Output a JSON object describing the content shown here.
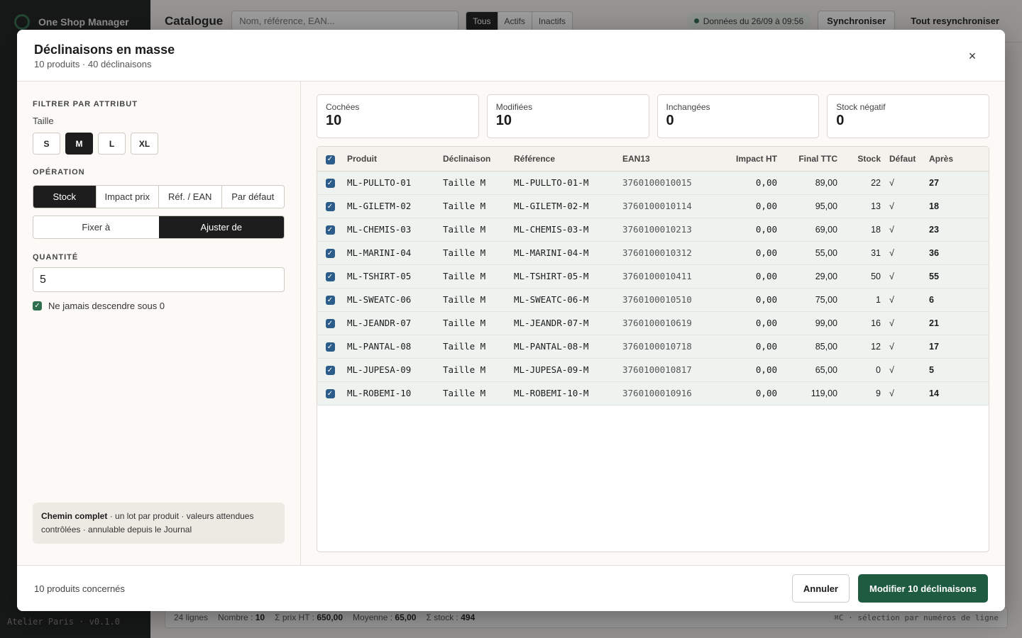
{
  "app": {
    "name": "One Shop Manager",
    "version": "Atelier Paris · v0.1.0",
    "page_title": "Catalogue",
    "search_placeholder": "Nom, référence, EAN...",
    "filters": [
      "Tous",
      "Actifs",
      "Inactifs"
    ],
    "sync_badge": "Données du 26/09 à 09:56",
    "sync_button": "Synchroniser",
    "resync_button": "Tout resynchroniser",
    "statusbar": {
      "lines": "24 lignes",
      "count_label": "Nombre :",
      "count_value": "10",
      "price_label": "Σ prix HT :",
      "price_value": "650,00",
      "avg_label": "Moyenne :",
      "avg_value": "65,00",
      "stock_label": "Σ stock :",
      "stock_value": "494",
      "hint": "⌘C · sélection par numéros de ligne"
    }
  },
  "modal": {
    "title": "Déclinaisons en masse",
    "subtitle": "10 produits · 40 déclinaisons",
    "close_glyph": "×",
    "filter_label": "Filtrer par attribut",
    "attribute_label": "Taille",
    "sizes": [
      "S",
      "M",
      "L",
      "XL"
    ],
    "operation_label": "Opération",
    "operations": [
      "Stock",
      "Impact prix",
      "Réf. / EAN",
      "Par défaut"
    ],
    "modes": [
      "Fixer à",
      "Ajuster de"
    ],
    "quantity_label": "Quantité",
    "quantity_value": "5",
    "never_below_zero": "Ne jamais descendre sous 0",
    "info_bold": "Chemin complet",
    "info_text": " · un lot par produit · valeurs attendues contrôlées · annulable depuis le Journal",
    "stats": [
      {
        "label": "Cochées",
        "value": "10"
      },
      {
        "label": "Modifiées",
        "value": "10"
      },
      {
        "label": "Inchangées",
        "value": "0"
      },
      {
        "label": "Stock négatif",
        "value": "0"
      }
    ],
    "columns": [
      "Produit",
      "Déclinaison",
      "Référence",
      "EAN13",
      "Impact HT",
      "Final TTC",
      "Stock",
      "Défaut",
      "Après"
    ],
    "rows": [
      {
        "produit": "ML-PULLTO-01",
        "declinaison": "Taille M",
        "reference": "ML-PULLTO-01-M",
        "ean": "3760100010015",
        "impact": "0,00",
        "final": "89,00",
        "stock": "22",
        "defaut": "√",
        "apres": "27"
      },
      {
        "produit": "ML-GILETM-02",
        "declinaison": "Taille M",
        "reference": "ML-GILETM-02-M",
        "ean": "3760100010114",
        "impact": "0,00",
        "final": "95,00",
        "stock": "13",
        "defaut": "√",
        "apres": "18"
      },
      {
        "produit": "ML-CHEMIS-03",
        "declinaison": "Taille M",
        "reference": "ML-CHEMIS-03-M",
        "ean": "3760100010213",
        "impact": "0,00",
        "final": "69,00",
        "stock": "18",
        "defaut": "√",
        "apres": "23"
      },
      {
        "produit": "ML-MARINI-04",
        "declinaison": "Taille M",
        "reference": "ML-MARINI-04-M",
        "ean": "3760100010312",
        "impact": "0,00",
        "final": "55,00",
        "stock": "31",
        "defaut": "√",
        "apres": "36"
      },
      {
        "produit": "ML-TSHIRT-05",
        "declinaison": "Taille M",
        "reference": "ML-TSHIRT-05-M",
        "ean": "3760100010411",
        "impact": "0,00",
        "final": "29,00",
        "stock": "50",
        "defaut": "√",
        "apres": "55"
      },
      {
        "produit": "ML-SWEATC-06",
        "declinaison": "Taille M",
        "reference": "ML-SWEATC-06-M",
        "ean": "3760100010510",
        "impact": "0,00",
        "final": "75,00",
        "stock": "1",
        "defaut": "√",
        "apres": "6"
      },
      {
        "produit": "ML-JEANDR-07",
        "declinaison": "Taille M",
        "reference": "ML-JEANDR-07-M",
        "ean": "3760100010619",
        "impact": "0,00",
        "final": "99,00",
        "stock": "16",
        "defaut": "√",
        "apres": "21"
      },
      {
        "produit": "ML-PANTAL-08",
        "declinaison": "Taille M",
        "reference": "ML-PANTAL-08-M",
        "ean": "3760100010718",
        "impact": "0,00",
        "final": "85,00",
        "stock": "12",
        "defaut": "√",
        "apres": "17"
      },
      {
        "produit": "ML-JUPESA-09",
        "declinaison": "Taille M",
        "reference": "ML-JUPESA-09-M",
        "ean": "3760100010817",
        "impact": "0,00",
        "final": "65,00",
        "stock": "0",
        "defaut": "√",
        "apres": "5"
      },
      {
        "produit": "ML-ROBEMI-10",
        "declinaison": "Taille M",
        "reference": "ML-ROBEMI-10-M",
        "ean": "3760100010916",
        "impact": "0,00",
        "final": "119,00",
        "stock": "9",
        "defaut": "√",
        "apres": "14"
      }
    ],
    "footer_info": "10 produits concernés",
    "cancel_label": "Annuler",
    "submit_label": "Modifier 10 déclinaisons"
  },
  "colors": {
    "accent": "#1f5b40",
    "checkbox": "#2c5d8a",
    "row_bg": "#eef3f0"
  },
  "icons": {
    "close": "close-icon",
    "check": "checkmark-icon",
    "logo": "logo-ring-icon"
  }
}
